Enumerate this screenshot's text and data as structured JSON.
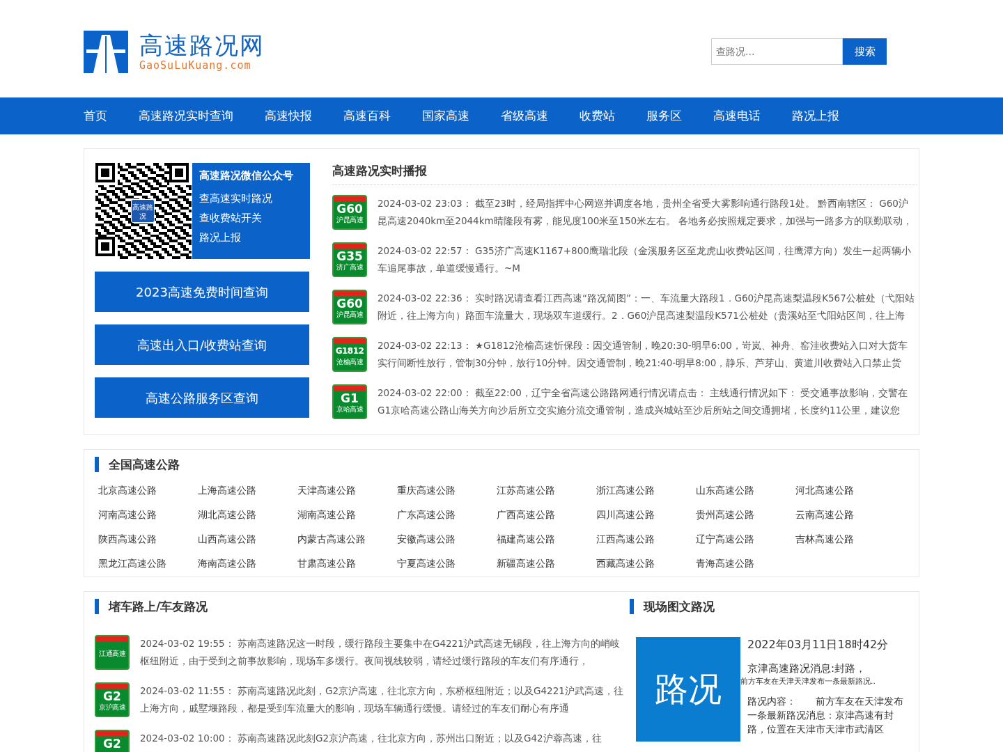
{
  "header": {
    "logo": {
      "title": "高速路况网",
      "subtitle": "GaoSuLuKuang.com"
    },
    "search": {
      "placeholder": "查路况...",
      "button": "搜索"
    }
  },
  "nav": [
    "首页",
    "高速路况实时查询",
    "高速快报",
    "高速百科",
    "国家高速",
    "省级高速",
    "收费站",
    "服务区",
    "高速电话",
    "路况上报"
  ],
  "wechat": {
    "qr_badge": "高速路况",
    "title": "高速路况微信公众号",
    "lines": [
      "查高速实时路况",
      "查收费站开关",
      "路况上报"
    ]
  },
  "quick_links": [
    "2023高速免费时间查询",
    "高速出入口/收费站查询",
    "高速公路服务区查询"
  ],
  "live": {
    "title": "高速路况实时播报",
    "items": [
      {
        "sign": {
          "code": "G60",
          "name": "沪昆高速"
        },
        "time": "2024-03-02 23:03：",
        "text": "截至23时，经局指挥中心网巡并调度各地，贵州全省受大雾影响通行路段1处。 黔西南辖区： G60沪昆高速2040km至2044km晴隆段有雾，能见度100米至150米左右。 各地务必按照规定要求，加强与一路多方的联勤联动，"
      },
      {
        "sign": {
          "code": "G35",
          "name": "济广高速"
        },
        "time": "2024-03-02 22:57：",
        "text": "G35济广高速K1167+800鹰瑞北段（金溪服务区至龙虎山收费站区间，往鹰潭方向）发生一起两辆小车追尾事故，单道缓慢通行。~M"
      },
      {
        "sign": {
          "code": "G60",
          "name": "沪昆高速"
        },
        "time": "2024-03-02 22:36：",
        "text": "实时路况请查看江西高速“路况简图”：一、车流量大路段1．G60沪昆高速梨温段K567公桩处（弋阳站附近，往上海方向）路面车流量大，现场双车道缓行。2．G60沪昆高速梨温段K571公桩处（贵溪站至弋阳站区间，往上海"
      },
      {
        "sign": {
          "code": "G1812",
          "name": "沧榆高速"
        },
        "time": "2024-03-02 22:13：",
        "text": "★G1812沧榆高速忻保段：因交通管制，晚20:30-明早6:00，岢岚、神舟、窑洼收费站入口对大货车实行间断性放行，管制30分钟，放行10分钟。因交通管制，晚21:40-明早8:00，静乐、芦芽山、黄道川收费站入口禁止货"
      },
      {
        "sign": {
          "code": "G1",
          "name": "京哈高速"
        },
        "time": "2024-03-02 22:00：",
        "text": "截至22:00，辽宁全省高速公路路网通行情况请点击： 主线通行情况如下： 受交通事故影响，交警在G1京哈高速公路山海关方向沙后所立交实施分流交通管制，造成兴城站至沙后所站之间交通拥堵，长度约11公里，建议您"
      }
    ]
  },
  "national": {
    "title": "全国高速公路",
    "roads": [
      "北京高速公路",
      "上海高速公路",
      "天津高速公路",
      "重庆高速公路",
      "江苏高速公路",
      "浙江高速公路",
      "山东高速公路",
      "河北高速公路",
      "河南高速公路",
      "湖北高速公路",
      "湖南高速公路",
      "广东高速公路",
      "广西高速公路",
      "四川高速公路",
      "贵州高速公路",
      "云南高速公路",
      "陕西高速公路",
      "山西高速公路",
      "内蒙古高速公路",
      "安徽高速公路",
      "福建高速公路",
      "江西高速公路",
      "辽宁高速公路",
      "吉林高速公路",
      "黑龙江高速公路",
      "海南高速公路",
      "甘肃高速公路",
      "宁夏高速公路",
      "新疆高速公路",
      "西藏高速公路",
      "青海高速公路"
    ]
  },
  "jam": {
    "title": "堵车路上/车友路况",
    "items": [
      {
        "sign": {
          "name": "江通高速"
        },
        "time": "2024-03-02 19:55：",
        "text": "苏南高速路况这一时段，缓行路段主要集中在G4221沪武高速无锡段，往上海方向的峭岐枢纽附近，由于受到之前事故影响，现场车多缓行。夜间视线较弱，请经过缓行路段的车友们有序通行，"
      },
      {
        "sign": {
          "code": "G2",
          "name": "京沪高速"
        },
        "time": "2024-03-02 11:55：",
        "text": "苏南高速路况此刻，G2京沪高速，往北京方向，东桥枢纽附近；以及G4221沪武高速，往上海方向，戚墅堰路段，都是受到车流量大的影响，现场车辆通行缓慢。请经过的车友们耐心有序通"
      },
      {
        "sign": {
          "code": "G2"
        },
        "time": "2024-03-02 10:00：",
        "text": "苏南高速路况此刻G2京沪高速，往北京方向，苏州出口附近；以及G42沪蓉高速，往"
      }
    ]
  },
  "photo": {
    "title": "现场图文路况",
    "image_text": "路况",
    "date": "2022年03月11日18时42分",
    "headline": "京津高速路况消息:封路，",
    "summary": "前方车友在天津天津发布一条最新路况..",
    "content": "路况内容：　　前方车友在天津发布一条最新路况消息：京津高速有封路，位置在天津市天津市武清区"
  }
}
